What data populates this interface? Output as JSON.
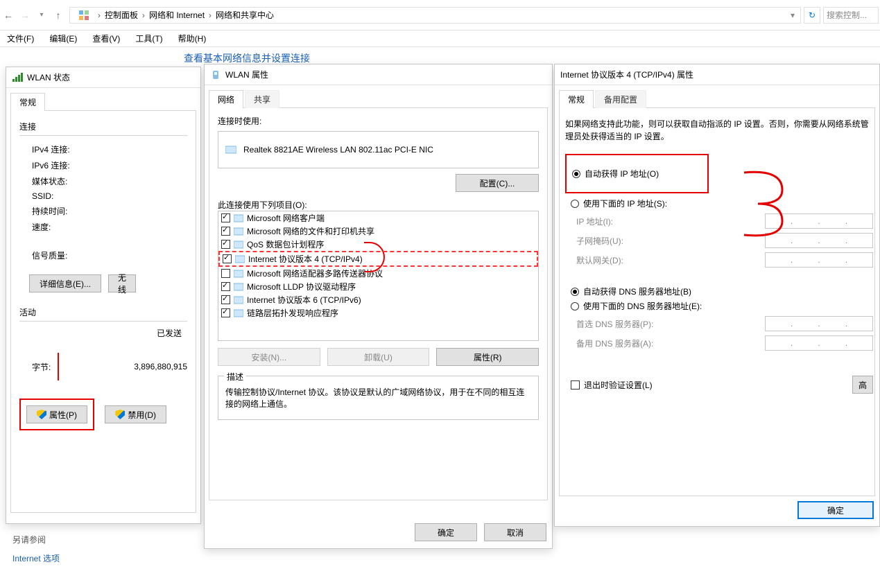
{
  "nav": {
    "breadcrumb": [
      "控制面板",
      "网络和 Internet",
      "网络和共享中心"
    ],
    "search_placeholder": "搜索控制..."
  },
  "menubar": [
    "文件(F)",
    "编辑(E)",
    "查看(V)",
    "工具(T)",
    "帮助(H)"
  ],
  "page_heading": "查看基本网络信息并设置连接",
  "status": {
    "title": "WLAN 状态",
    "tab_general": "常规",
    "grp_connection": "连接",
    "rows": {
      "ipv4": "IPv4 连接:",
      "ipv6": "IPv6 连接:",
      "media": "媒体状态:",
      "ssid": "SSID:",
      "duration": "持续时间:",
      "speed": "速度:",
      "signal": "信号质量:"
    },
    "btn_details": "详细信息(E)...",
    "btn_wireless": "无线",
    "grp_activity": "活动",
    "sent": "已发送",
    "bytes_label": "字节:",
    "bytes_value": "3,896,880,915",
    "btn_properties": "属性(P)",
    "btn_disable": "禁用(D)"
  },
  "props": {
    "title": "WLAN 属性",
    "tab_network": "网络",
    "tab_share": "共享",
    "connect_using": "连接时使用:",
    "adapter": "Realtek 8821AE Wireless LAN 802.11ac PCI-E NIC",
    "btn_configure": "配置(C)...",
    "uses_items": "此连接使用下列项目(O):",
    "items": [
      {
        "checked": true,
        "label": "Microsoft 网络客户端"
      },
      {
        "checked": true,
        "label": "Microsoft 网络的文件和打印机共享"
      },
      {
        "checked": true,
        "label": "QoS 数据包计划程序"
      },
      {
        "checked": true,
        "label": "Internet 协议版本 4 (TCP/IPv4)",
        "selected": true
      },
      {
        "checked": false,
        "label": "Microsoft 网络适配器多路传送器协议"
      },
      {
        "checked": true,
        "label": "Microsoft LLDP 协议驱动程序"
      },
      {
        "checked": true,
        "label": "Internet 协议版本 6 (TCP/IPv6)"
      },
      {
        "checked": true,
        "label": "链路层拓扑发现响应程序"
      }
    ],
    "btn_install": "安装(N)...",
    "btn_uninstall": "卸载(U)",
    "btn_item_props": "属性(R)",
    "grp_desc": "描述",
    "desc_text": "传输控制协议/Internet 协议。该协议是默认的广域网络协议，用于在不同的相互连接的网络上通信。",
    "btn_ok": "确定",
    "btn_cancel": "取消"
  },
  "ipv4": {
    "title": "Internet 协议版本 4 (TCP/IPv4) 属性",
    "tab_general": "常规",
    "tab_alt": "备用配置",
    "note": "如果网络支持此功能，则可以获取自动指派的 IP 设置。否则，你需要从网络系统管理员处获得适当的 IP 设置。",
    "opt_auto_ip": "自动获得 IP 地址(O)",
    "opt_manual_ip": "使用下面的 IP 地址(S):",
    "lbl_ip": "IP 地址(I):",
    "lbl_mask": "子网掩码(U):",
    "lbl_gw": "默认网关(D):",
    "opt_auto_dns": "自动获得 DNS 服务器地址(B)",
    "opt_manual_dns": "使用下面的 DNS 服务器地址(E):",
    "lbl_dns1": "首选 DNS 服务器(P):",
    "lbl_dns2": "备用 DNS 服务器(A):",
    "chk_validate": "退出时验证设置(L)",
    "btn_advanced": "高",
    "btn_ok": "确定"
  },
  "seealso": {
    "heading": "另请参阅",
    "link1": "Internet 选项"
  }
}
